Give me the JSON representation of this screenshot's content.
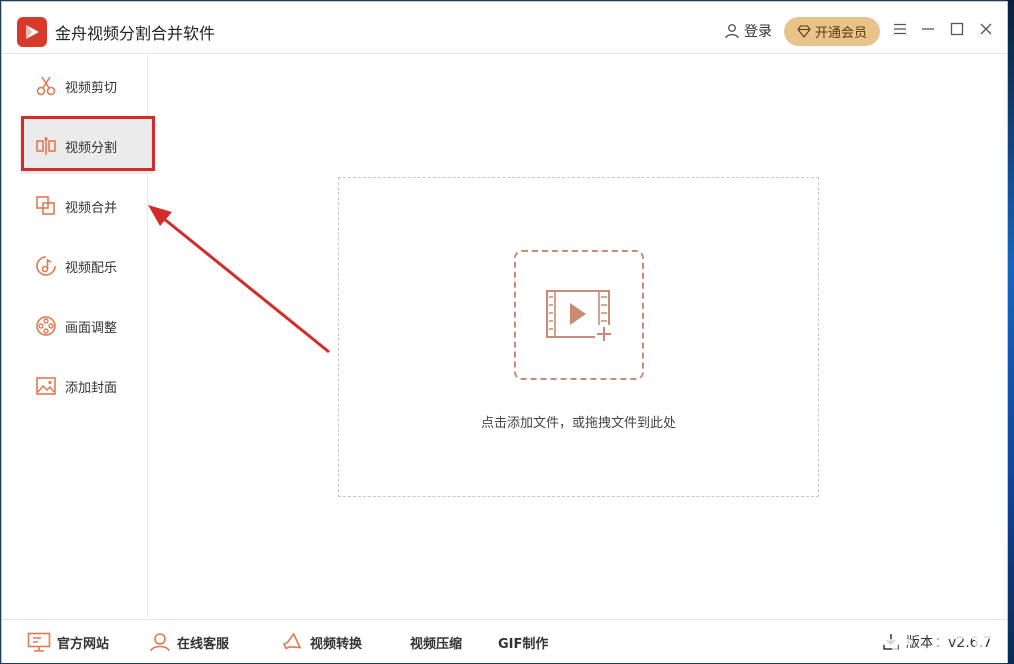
{
  "app": {
    "title": "金舟视频分割合并软件"
  },
  "header": {
    "login_label": "登录",
    "vip_label": "开通会员"
  },
  "sidebar": {
    "items": [
      {
        "label": "视频剪切",
        "icon": "scissors-icon"
      },
      {
        "label": "视频分割",
        "icon": "split-icon",
        "active": true
      },
      {
        "label": "视频合并",
        "icon": "merge-icon"
      },
      {
        "label": "视频配乐",
        "icon": "music-icon"
      },
      {
        "label": "画面调整",
        "icon": "film-reel-icon"
      },
      {
        "label": "添加封面",
        "icon": "image-icon"
      }
    ]
  },
  "main": {
    "drop_hint": "点击添加文件，或拖拽文件到此处"
  },
  "footer": {
    "website": "官方网站",
    "support": "在线客服",
    "convert": "视频转换",
    "compress": "视频压缩",
    "gif": "GIF制作",
    "version": "版本：v2.6.7"
  },
  "colors": {
    "accent": "#e07a52",
    "vip": "#e8c38a",
    "highlight": "#d62b2b",
    "logo": "#d83a2b"
  }
}
